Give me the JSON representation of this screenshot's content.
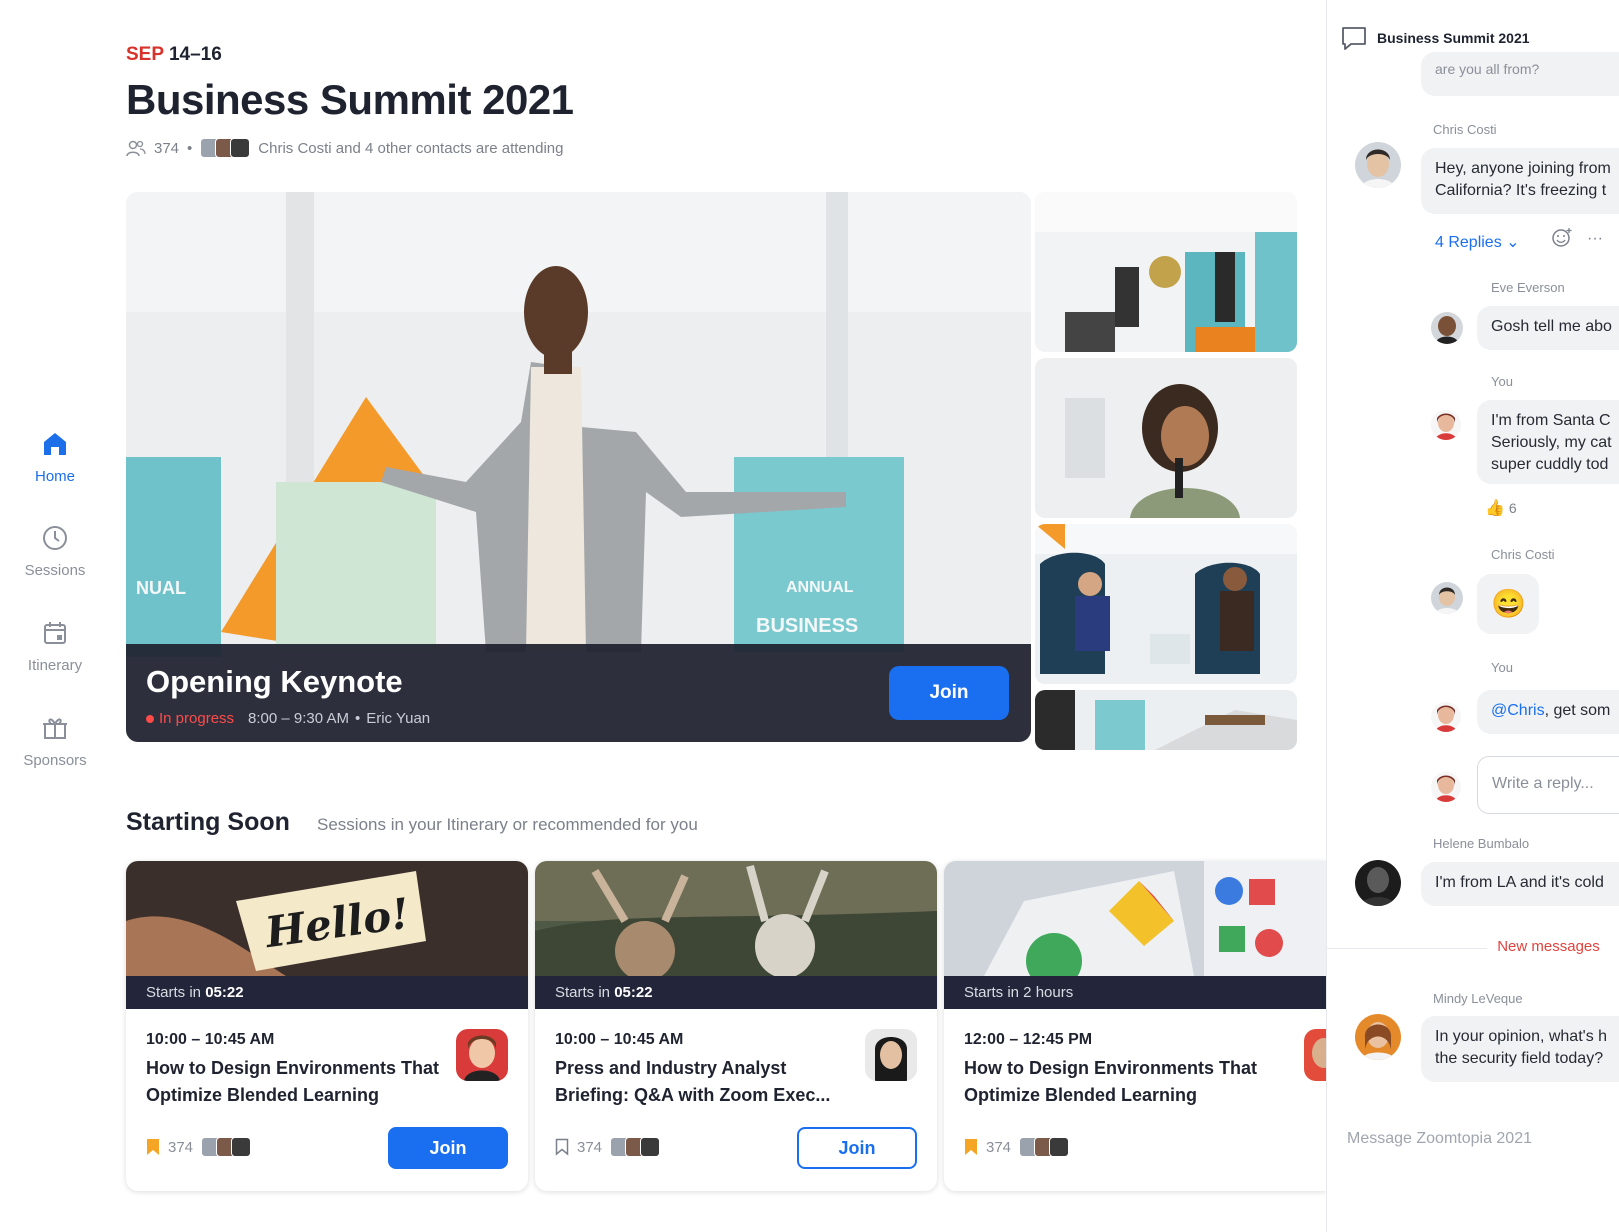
{
  "nav": {
    "items": [
      {
        "label": "Home",
        "icon": "home-icon",
        "active": true
      },
      {
        "label": "Sessions",
        "icon": "clock-icon",
        "active": false
      },
      {
        "label": "Itinerary",
        "icon": "calendar-icon",
        "active": false
      },
      {
        "label": "Sponsors",
        "icon": "gift-icon",
        "active": false
      }
    ]
  },
  "event": {
    "date_month": "SEP",
    "date_days": "14–16",
    "title": "Business Summit 2021",
    "attendee_count": "374",
    "separator": "•",
    "contacts_text": "Chris Costi and 4 other contacts are attending"
  },
  "hero": {
    "session_title": "Opening Keynote",
    "status": "In progress",
    "time": "8:00 – 9:30 AM",
    "separator": "•",
    "speaker": "Eric Yuan",
    "join_label": "Join",
    "sign_text_1": "ANNUAL",
    "sign_text_2": "BUSINESS",
    "sign_text_left": "NUAL"
  },
  "starting_soon": {
    "title": "Starting Soon",
    "subtitle": "Sessions in your Itinerary or recommended for you",
    "cards": [
      {
        "starts_prefix": "Starts in",
        "starts_value": "05:22",
        "time": "10:00 – 10:45 AM",
        "title": "How to Design Environments That Optimize Blended Learning",
        "count": "374",
        "bookmarked": true,
        "join_label": "Join",
        "join_style": "primary",
        "image_text": "Hello!"
      },
      {
        "starts_prefix": "Starts in",
        "starts_value": "05:22",
        "time": "10:00 – 10:45 AM",
        "title": "Press and Industry Analyst Briefing: Q&A with Zoom Exec...",
        "count": "374",
        "bookmarked": false,
        "join_label": "Join",
        "join_style": "outline"
      },
      {
        "starts_prefix": "Starts in 2 hours",
        "starts_value": "",
        "time": "12:00 – 12:45 PM",
        "title": "How to Design Environments That Optimize Blended Learning",
        "count": "374",
        "bookmarked": true
      }
    ]
  },
  "chat": {
    "title": "Business Summit 2021",
    "top_partial": "are you all from?",
    "messages": [
      {
        "name": "Chris Costi",
        "text": "Hey, anyone joining from",
        "text2": "California? It's freezing t"
      },
      {
        "replies": "4 Replies ⌄",
        "more": "···"
      },
      {
        "name": "Eve Everson",
        "text": "Gosh tell me abo"
      },
      {
        "name": "You",
        "text": "I'm from Santa C",
        "text2": "Seriously, my cat",
        "text3": "super cuddly tod",
        "reaction_count": "6"
      },
      {
        "name": "Chris Costi",
        "text": "😄"
      },
      {
        "name": "You",
        "mention": "@Chris",
        "text": ", get som"
      },
      {
        "name": "Helene Bumbalo",
        "text": "I'm from LA and it's cold"
      },
      {
        "name": "Mindy LeVeque",
        "text": "In your opinion, what's h",
        "text2": "the security field today?"
      }
    ],
    "reply_placeholder": "Write a reply...",
    "new_messages": "New messages",
    "composer_placeholder": "Message Zoomtopia 2021"
  },
  "colors": {
    "accent": "#1a6ff0",
    "danger": "#e0443f",
    "dark": "#1e212e"
  }
}
